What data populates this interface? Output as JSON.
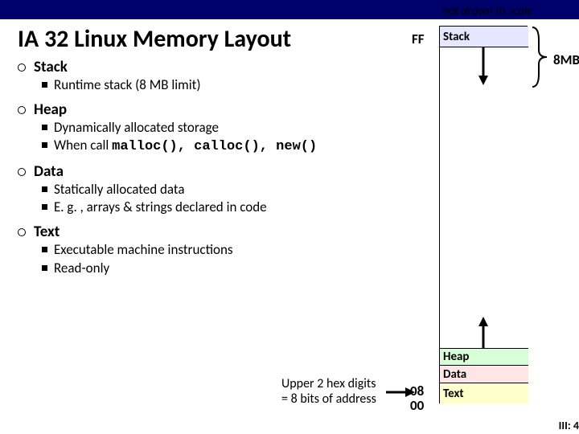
{
  "title": "IA 32 Linux Memory Layout",
  "note": "not drawn to scale",
  "addr_top": "FF",
  "addr_text": "08",
  "addr_bottom": "00",
  "eight_mb": "8MB",
  "regions": {
    "stack": "Stack",
    "heap": "Heap",
    "data": "Data",
    "text": "Text"
  },
  "sections": {
    "stack": {
      "head": "Stack",
      "items": [
        "Runtime stack (8 MB limit)"
      ]
    },
    "heap": {
      "head": "Heap"
    },
    "heap_items": {
      "a": "Dynamically allocated storage",
      "b_prefix": "When call ",
      "b_code": "malloc(), calloc(), new()"
    },
    "data": {
      "head": "Data",
      "items": [
        "Statically allocated data",
        "E. g. , arrays & strings declared in code"
      ]
    },
    "text": {
      "head": "Text",
      "items": [
        "Executable machine instructions",
        "Read-only"
      ]
    }
  },
  "caption": {
    "l1": "Upper 2 hex digits",
    "l2": "= 8 bits of address"
  },
  "page": "III: 4"
}
